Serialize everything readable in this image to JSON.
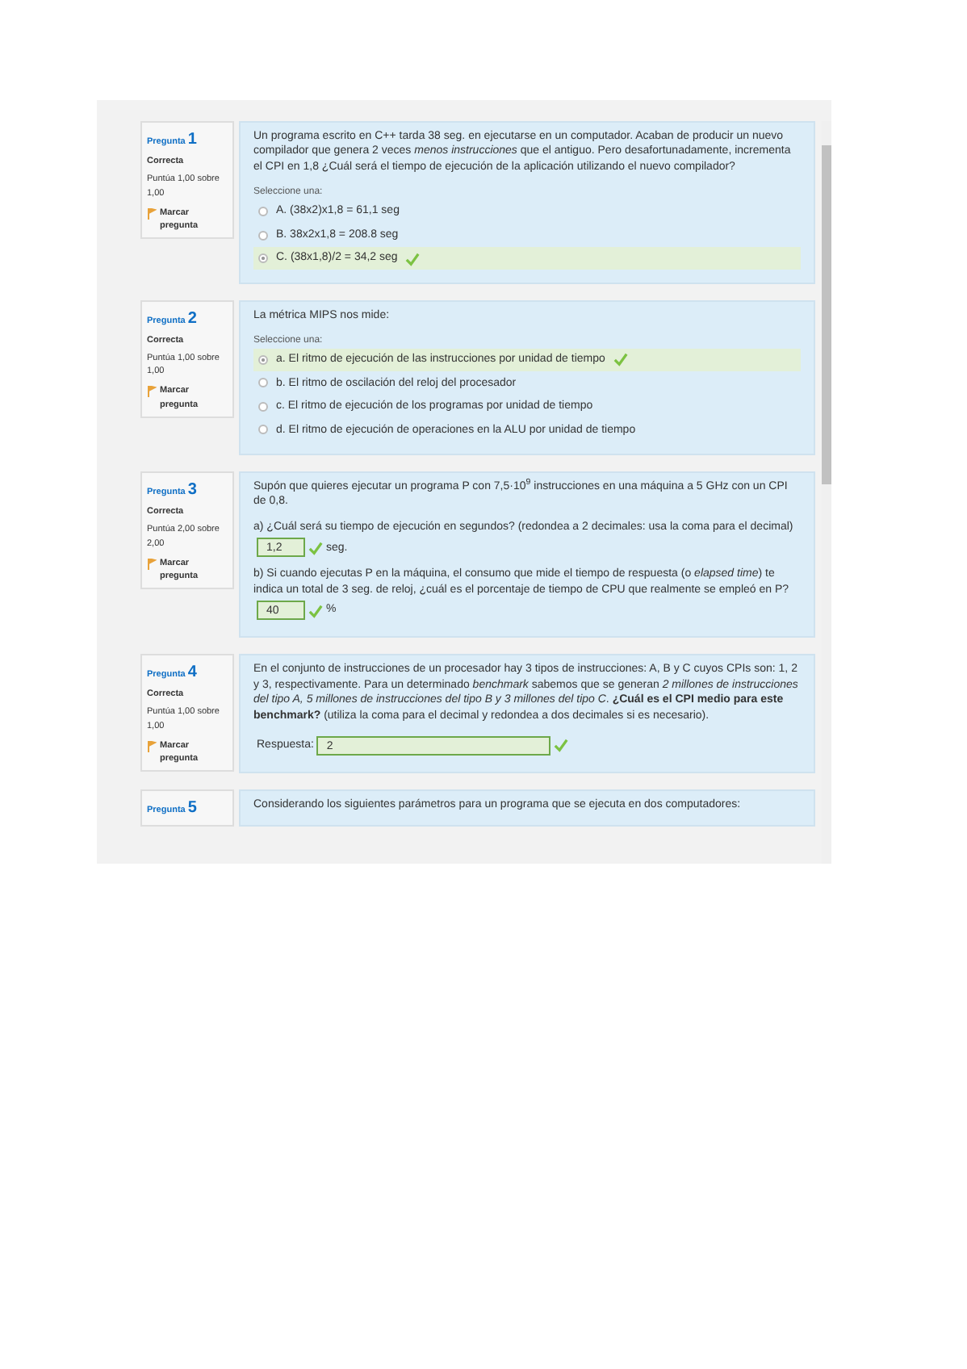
{
  "questions": [
    {
      "kind": "choice",
      "number": "1",
      "heading": "Pregunta",
      "state": "Correcta",
      "grade": "Puntúa 1,00 sobre 1,00",
      "flag": "Marcar pregunta",
      "text": "Un programa escrito en C++ tarda 38 seg. en ejecutarse en un computador. Acaban de producir un nuevo compilador que genera 2 veces *menos instrucciones* que el antiguo. Pero desafortunadamente, incrementa el CPI en 1,8 ¿Cuál será el tiempo de ejecución de la aplicación utilizando el nuevo compilador?",
      "prompt": "Seleccione una:",
      "options": [
        {
          "label": "A. (38x2)x1,8 = 61,1 seg",
          "selected": false
        },
        {
          "label": "B. 38x2x1,8 = 208.8 seg",
          "selected": false
        },
        {
          "label": "C. (38x1,8)/2 = 34,2 seg",
          "selected": true
        }
      ]
    },
    {
      "kind": "choice",
      "number": "2",
      "heading": "Pregunta",
      "state": "Correcta",
      "grade": "Puntúa 1,00 sobre 1,00",
      "flag": "Marcar pregunta",
      "text": "La métrica MIPS nos mide:",
      "prompt": "Seleccione una:",
      "options": [
        {
          "label": "a. El ritmo de ejecución de las instrucciones por unidad de tiempo",
          "selected": true
        },
        {
          "label": "b. El ritmo de oscilación del reloj del procesador",
          "selected": false
        },
        {
          "label": "c. El ritmo de ejecución de los programas por unidad de tiempo",
          "selected": false
        },
        {
          "label": "d. El ritmo de ejecución de operaciones en la ALU por unidad de tiempo",
          "selected": false
        }
      ]
    },
    {
      "kind": "parts",
      "number": "3",
      "heading": "Pregunta",
      "state": "Correcta",
      "grade": "Puntúa 2,00 sobre 2,00",
      "flag": "Marcar pregunta",
      "text": "Supón que quieres ejecutar un programa P con 7,5·10$^{9}$ instrucciones en una máquina a 5 GHz con un CPI de 0,8.",
      "parts": [
        {
          "text": "a) ¿Cuál será su tiempo de ejecución en segundos? (redondea a 2 decimales: usa la coma para el decimal)",
          "value": "1,2",
          "unit": "seg."
        },
        {
          "text": "b) Si cuando ejecutas P en la máquina, el consumo que mide el tiempo de respuesta (o *elapsed time*) te indica un total de 3 seg. de reloj, ¿cuál es el porcentaje de tiempo de CPU que realmente se empleó en P?",
          "value": "40",
          "unit": "%"
        }
      ]
    },
    {
      "kind": "answer",
      "number": "4",
      "heading": "Pregunta",
      "state": "Correcta",
      "grade": "Puntúa 1,00 sobre 1,00",
      "flag": "Marcar pregunta",
      "text": "En el conjunto de instrucciones de un procesador hay 3 tipos de instrucciones: A, B y C cuyos CPIs son: 1, 2 y 3, respectivamente. Para un determinado *benchmark* sabemos que se generan *2 millones de instrucciones del tipo A, 5 millones de instrucciones del tipo B y 3 millones del tipo C*. **¿Cuál es el CPI medio para este benchmark?** (utiliza la coma para el decimal y redondea a dos decimales si es necesario).",
      "label": "Respuesta:",
      "value": "2"
    },
    {
      "kind": "cut",
      "number": "5",
      "heading": "Pregunta",
      "text": "Considerando los siguientes parámetros para un programa que se ejecuta en dos computadores:"
    }
  ]
}
